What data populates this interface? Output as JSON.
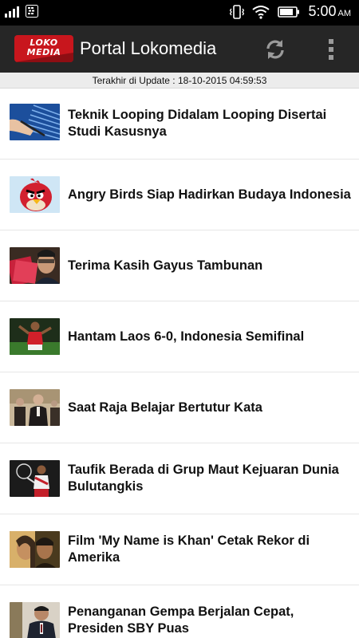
{
  "status_bar": {
    "time": "5:00",
    "ampm": "AM"
  },
  "app": {
    "logo_text": "LOKO MEDIA",
    "title": "Portal Lokomedia"
  },
  "update_text": "Terakhir di Update : 18-10-2015 04:59:53",
  "news": [
    {
      "title": "Teknik Looping Didalam Looping Disertai Studi Kasusnya",
      "thumb": "hand-pen-image"
    },
    {
      "title": "Angry Birds Siap Hadirkan Budaya Indonesia",
      "thumb": "angry-bird-image"
    },
    {
      "title": "Terima Kasih Gayus Tambunan",
      "thumb": "money-portrait-image"
    },
    {
      "title": "Hantam Laos 6-0, Indonesia Semifinal",
      "thumb": "soccer-player-image"
    },
    {
      "title": "Saat Raja Belajar Bertutur Kata",
      "thumb": "king-speech-image"
    },
    {
      "title": "Taufik Berada di Grup Maut Kejuaran Dunia Bulutangkis",
      "thumb": "badminton-player-image"
    },
    {
      "title": "Film 'My Name is Khan' Cetak Rekor di Amerika",
      "thumb": "film-poster-image"
    },
    {
      "title": "Penanganan Gempa Berjalan Cepat, Presiden SBY Puas",
      "thumb": "president-image"
    }
  ]
}
